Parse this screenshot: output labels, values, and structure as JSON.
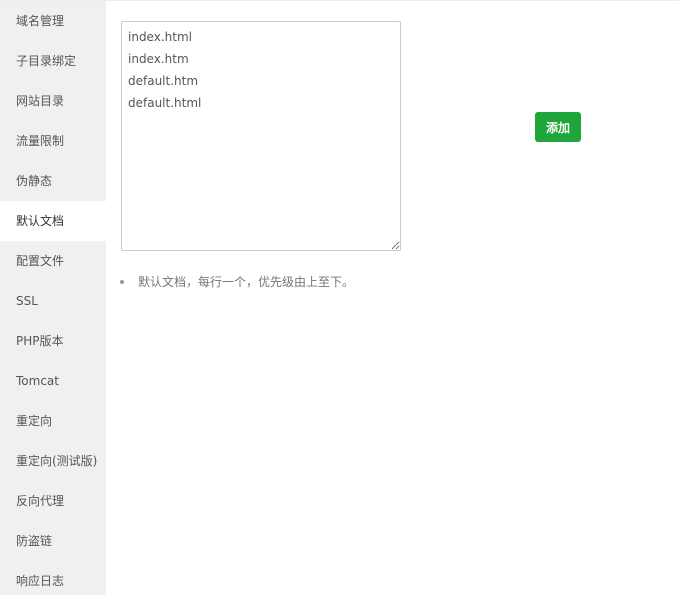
{
  "sidebar": {
    "items": [
      {
        "label": "域名管理"
      },
      {
        "label": "子目录绑定"
      },
      {
        "label": "网站目录"
      },
      {
        "label": "流量限制"
      },
      {
        "label": "伪静态"
      },
      {
        "label": "默认文档"
      },
      {
        "label": "配置文件"
      },
      {
        "label": "SSL"
      },
      {
        "label": "PHP版本"
      },
      {
        "label": "Tomcat"
      },
      {
        "label": "重定向"
      },
      {
        "label": "重定向(测试版)"
      },
      {
        "label": "反向代理"
      },
      {
        "label": "防盗链"
      },
      {
        "label": "响应日志"
      }
    ],
    "active_index": 5
  },
  "main": {
    "default_docs_value": "index.html\nindex.htm\ndefault.htm\ndefault.html",
    "add_button_label": "添加",
    "help_items": [
      "默认文档，每行一个，优先级由上至下。"
    ]
  },
  "colors": {
    "sidebar_bg": "#f0f0f0",
    "active_item_bg": "#ffffff",
    "add_button_bg": "#20a53a"
  }
}
